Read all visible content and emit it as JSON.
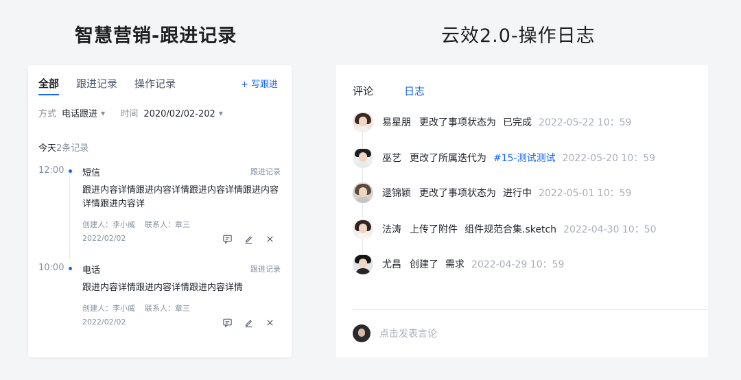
{
  "headings": {
    "left": "智慧营销-跟进记录",
    "right": "云效2.0-操作日志"
  },
  "followup": {
    "tabs": [
      "全部",
      "跟进记录",
      "操作记录"
    ],
    "write_button": "+ 写跟进",
    "filters": {
      "method_label": "方式",
      "method_value": "电话跟进",
      "time_label": "时间",
      "time_value": "2020/02/02-202"
    },
    "group": {
      "label": "今天",
      "count": "2条记录"
    },
    "entries": [
      {
        "time": "12:00",
        "kind": "短信",
        "tag": "跟进记录",
        "content": "跟进内容详情跟进内容详情跟进内容详情跟进内容详情跟进内容详",
        "creator": "创建人：李小威",
        "contact": "联系人：章三",
        "date": "2022/02/02"
      },
      {
        "time": "10:00",
        "kind": "电话",
        "tag": "跟进记录",
        "content": "跟进内容详情跟进内容详情跟进内容详情",
        "creator": "创建人：李小威",
        "contact": "联系人：章三",
        "date": "2022/02/02"
      }
    ],
    "action_icons": [
      "comment-icon",
      "edit-icon",
      "close-icon"
    ]
  },
  "oplog": {
    "tabs": [
      "评论",
      "日志"
    ],
    "active_tab": "日志",
    "logs": [
      {
        "name": "易星朋",
        "action": "更改了事项状态为",
        "target": "已完成",
        "time": "2022-05-22 10：59",
        "target_is_link": false
      },
      {
        "name": "巫艺",
        "action": "更改了所属迭代为",
        "target": "#15-测试测试",
        "time": "2022-05-20 10：59",
        "target_is_link": true
      },
      {
        "name": "逯锦颖",
        "action": "更改了事项状态为",
        "target": "进行中",
        "time": "2022-05-01 10：59",
        "target_is_link": false
      },
      {
        "name": "法涛",
        "action": "上传了附件",
        "target": "组件规范合集.sketch",
        "time": "2022-04-30 10：50",
        "target_is_link": false
      },
      {
        "name": "尤昌",
        "action": "创建了",
        "target": "需求",
        "time": "2022-04-29 10：59",
        "target_is_link": false
      }
    ],
    "comment_placeholder": "点击发表言论",
    "colors": {
      "accent": "#1664ff",
      "muted": "#a9aeb8"
    }
  }
}
